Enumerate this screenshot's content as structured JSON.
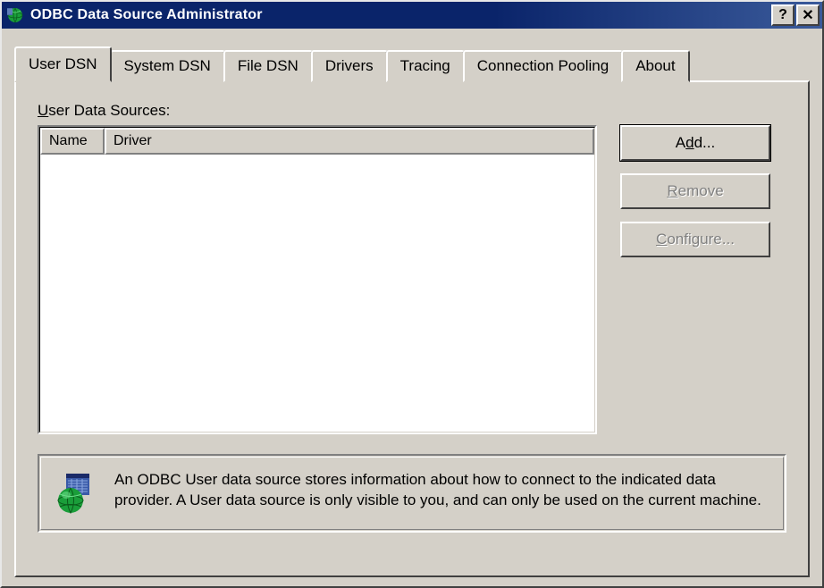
{
  "window": {
    "title": "ODBC Data Source Administrator"
  },
  "tabs": {
    "user_dsn": "User DSN",
    "system_dsn": "System DSN",
    "file_dsn": "File DSN",
    "drivers": "Drivers",
    "tracing": "Tracing",
    "connection_pooling": "Connection Pooling",
    "about": "About"
  },
  "section": {
    "label_prefix": "U",
    "label_suffix": "ser Data Sources:"
  },
  "columns": {
    "name": "Name",
    "driver": "Driver"
  },
  "buttons": {
    "add_prefix": "A",
    "add_underline": "d",
    "add_suffix": "d...",
    "remove_underline": "R",
    "remove_suffix": "emove",
    "configure_underline": "C",
    "configure_suffix": "onfigure..."
  },
  "info": {
    "text": "An ODBC User data source stores information about how to connect to the indicated data provider.   A User data source is only visible to you, and can only be used on the current machine."
  }
}
